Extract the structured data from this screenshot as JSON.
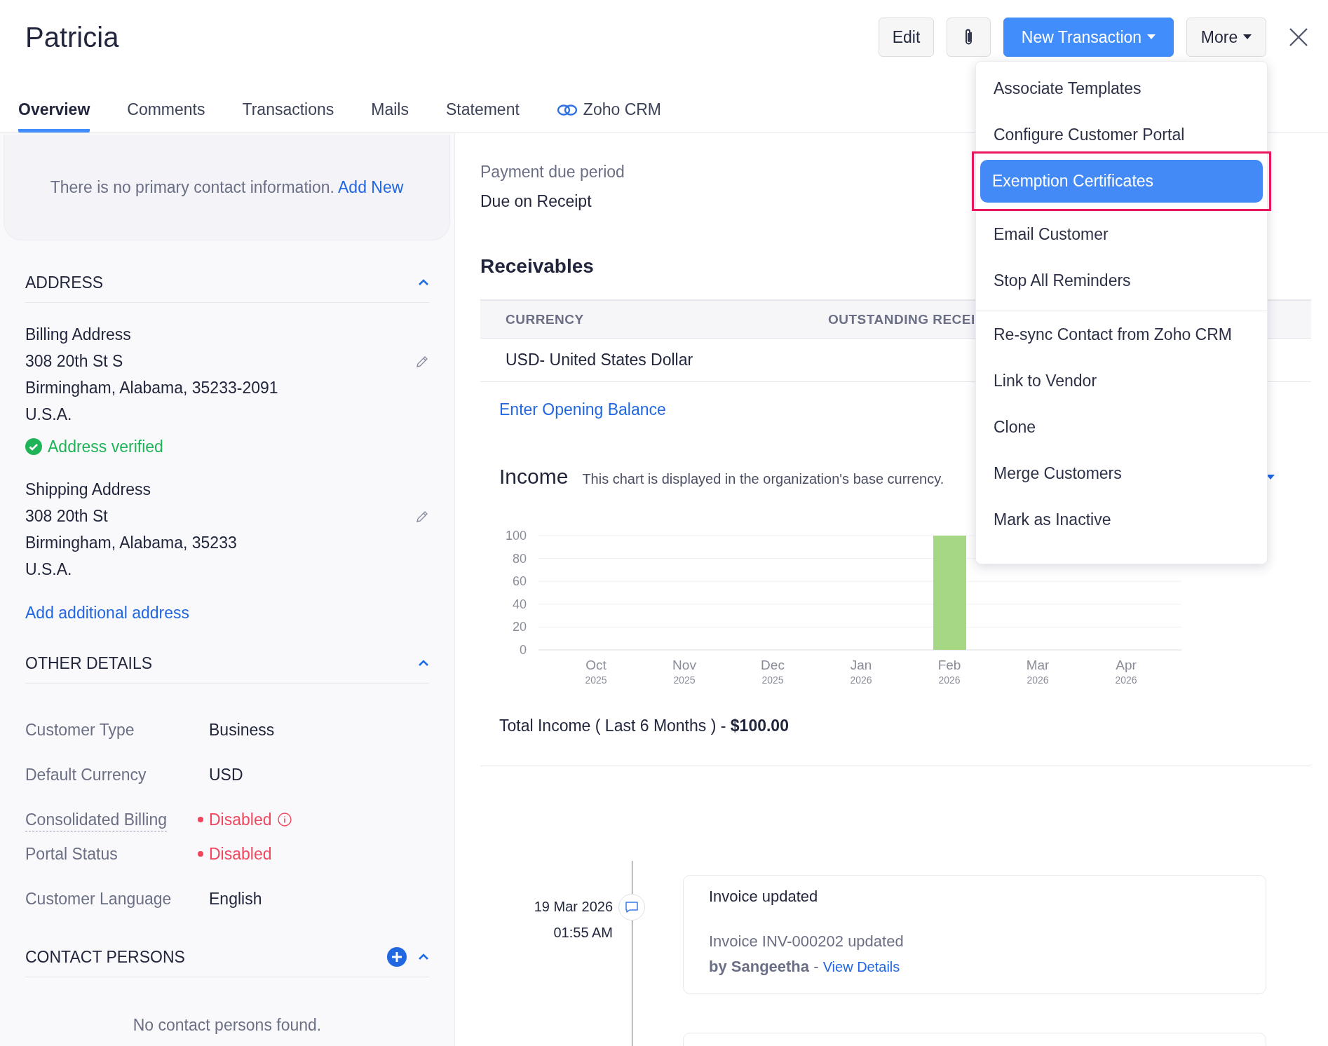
{
  "header": {
    "title": "Patricia",
    "buttons": [
      {
        "kind": "plain",
        "label": "Edit"
      },
      {
        "kind": "attach"
      },
      {
        "kind": "primary",
        "label": "New Transaction"
      },
      {
        "kind": "menu",
        "label": "More"
      }
    ]
  },
  "tabs": [
    {
      "label": "Overview",
      "selected": true,
      "kind": "text"
    },
    {
      "label": "Comments",
      "selected": false,
      "kind": "text"
    },
    {
      "label": "Transactions",
      "selected": false,
      "kind": "text"
    },
    {
      "label": "Mails",
      "selected": false,
      "kind": "text"
    },
    {
      "label": "Statement",
      "selected": false,
      "kind": "text"
    },
    {
      "label": "Zoho CRM",
      "selected": false,
      "kind": "linked"
    }
  ],
  "contact_card": {
    "message": "There is no primary contact information.",
    "link": "Add New"
  },
  "address": {
    "heading": "ADDRESS",
    "expanded": true,
    "blocks": [
      {
        "title": "Billing Address",
        "lines": [
          "308 20th St S",
          "Birmingham, Alabama, 35233-2091",
          "U.S.A."
        ],
        "verified": true,
        "verified_label": "Address verified"
      },
      {
        "title": "Shipping Address",
        "lines": [
          "308 20th St",
          "Birmingham, Alabama, 35233",
          "U.S.A."
        ],
        "verified": false
      }
    ],
    "add_link": "Add additional address"
  },
  "other_details": {
    "heading": "OTHER DETAILS",
    "expanded": true,
    "rows": [
      {
        "label": "Customer Type",
        "value": "Business",
        "kind": "text",
        "info": false
      },
      {
        "label": "Default Currency",
        "value": "USD",
        "kind": "text",
        "info": false
      },
      {
        "label": "Consolidated Billing",
        "value": "Disabled",
        "kind": "status",
        "info": true
      },
      {
        "label": "Portal Status",
        "value": "Disabled",
        "kind": "status",
        "info": false
      },
      {
        "label": "Customer Language",
        "value": "English",
        "kind": "text",
        "info": false
      }
    ]
  },
  "contact_persons": {
    "heading": "CONTACT PERSONS",
    "expanded": true,
    "empty_message": "No contact persons found."
  },
  "payment": {
    "label": "Payment due period",
    "value": "Due on Receipt"
  },
  "receivables": {
    "title": "Receivables",
    "columns": [
      "CURRENCY",
      "OUTSTANDING RECEI"
    ],
    "rows": [
      {
        "currency": "USD- United States Dollar"
      }
    ],
    "link": "Enter Opening Balance"
  },
  "income": {
    "title": "Income",
    "note": "This chart is displayed in the organization's base currency.",
    "chart_data": {
      "type": "bar",
      "categories": [
        "Oct 2025",
        "Nov 2025",
        "Dec 2025",
        "Jan 2026",
        "Feb 2026",
        "Mar 2026",
        "Apr 2026"
      ],
      "series": [
        {
          "color": "#a6d785",
          "values": [
            0,
            0,
            0,
            0,
            100,
            0,
            0
          ]
        }
      ],
      "grid": true,
      "ylim": [
        0,
        100
      ],
      "yticks": [
        0,
        20,
        40,
        60,
        80,
        100
      ]
    },
    "total": "Total Income ( Last 6 Months ) - **$100.00**"
  },
  "timeline": [
    {
      "date": "19 Mar 2026",
      "time": "01:55 AM",
      "title": "Invoice updated",
      "description": "Invoice INV-000202 updated",
      "author": "by Sangeetha",
      "separator": "-",
      "link": "View Details"
    }
  ],
  "more_menu": {
    "items": [
      {
        "label": "Associate Templates",
        "selected": false,
        "outlined": false,
        "divider_before": false
      },
      {
        "label": "Configure Customer Portal",
        "selected": false,
        "outlined": false,
        "divider_before": false
      },
      {
        "label": "Exemption Certificates",
        "selected": true,
        "outlined": true,
        "divider_before": false
      },
      {
        "label": "Email Customer",
        "selected": false,
        "outlined": false,
        "divider_before": false
      },
      {
        "label": "Stop All Reminders",
        "selected": false,
        "outlined": false,
        "divider_before": false
      },
      {
        "label": "Re-sync Contact from Zoho CRM",
        "selected": false,
        "outlined": false,
        "divider_before": true
      },
      {
        "label": "Link to Vendor",
        "selected": false,
        "outlined": false,
        "divider_before": false
      },
      {
        "label": "Clone",
        "selected": false,
        "outlined": false,
        "divider_before": false
      },
      {
        "label": "Merge Customers",
        "selected": false,
        "outlined": false,
        "divider_before": false
      },
      {
        "label": "Mark as Inactive",
        "selected": false,
        "outlined": false,
        "divider_before": false
      }
    ]
  }
}
